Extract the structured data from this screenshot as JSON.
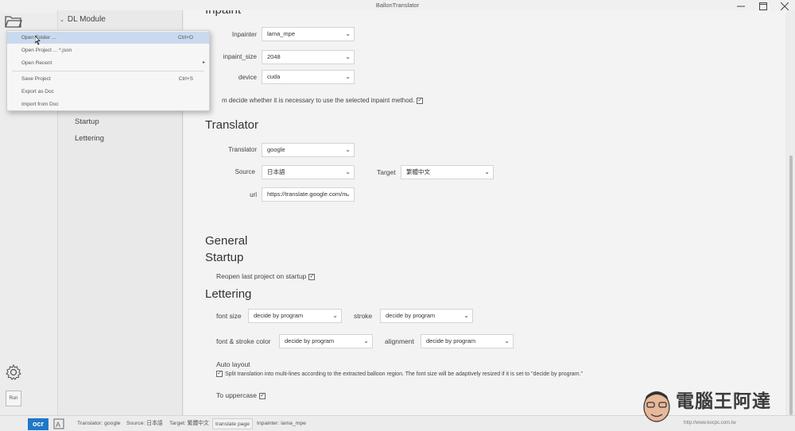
{
  "window": {
    "title": "BallonTranslator"
  },
  "nav": {
    "header": "DL Module",
    "items": [
      {
        "label": "Startup"
      },
      {
        "label": "Lettering"
      }
    ]
  },
  "inpaint": {
    "title_partial": "Inpaint",
    "inpainter_label": "Inpainter",
    "inpainter_value": "lama_mpe",
    "size_label": "inpaint_size",
    "size_value": "2048",
    "device_label": "device",
    "device_value": "cuda",
    "check_text": "m decide whether it is necessary to use the selected inpaint method."
  },
  "translator": {
    "title": "Translator",
    "translator_label": "Translator",
    "translator_value": "google",
    "source_label": "Source",
    "source_value": "日本語",
    "target_label": "Target",
    "target_value": "繁體中文",
    "url_label": "url",
    "url_value": "https://translate.google.com/m"
  },
  "general": {
    "title": "General",
    "startup_title": "Startup",
    "reopen_label": "Reopen last project on startup"
  },
  "lettering": {
    "title": "Lettering",
    "font_size_label": "font size",
    "font_size_value": "decide by program",
    "stroke_label": "stroke",
    "stroke_value": "decide by program",
    "color_label": "font & stroke color",
    "color_value": "decide by program",
    "alignment_label": "alignment",
    "alignment_value": "decide by program",
    "auto_layout_label": "Auto layout",
    "auto_layout_text": "Split translation into multi-lines according to the extracted balloon region. The font size will be adaptively resized if it is set to \"decide by program.\"",
    "uppercase_label": "To uppercase"
  },
  "menu": {
    "items": [
      {
        "label": "Open Folder ...",
        "shortcut": "Ctrl+O"
      },
      {
        "label": "Open Project ... *.json",
        "shortcut": ""
      },
      {
        "label": "Open Recent",
        "shortcut": ""
      },
      {
        "label": "Save Project",
        "shortcut": "Ctrl+S"
      },
      {
        "label": "Export as Doc",
        "shortcut": ""
      },
      {
        "label": "Import from Doc",
        "shortcut": ""
      }
    ]
  },
  "sidebar": {
    "run_label": "Run"
  },
  "statusbar": {
    "ocr_label": "ocr",
    "translator": "Translator: google",
    "source": "Source: 日本語",
    "target": "Target: 繁體中文",
    "translate_page": "translate page",
    "inpainter": "Inpainter: lama_mpe"
  },
  "watermark": {
    "text": "電腦王阿達",
    "url": "http://www.kocpc.com.tw"
  },
  "colors": {
    "accent": "#1f78c8",
    "menu_highlight": "#c9d9ee"
  }
}
